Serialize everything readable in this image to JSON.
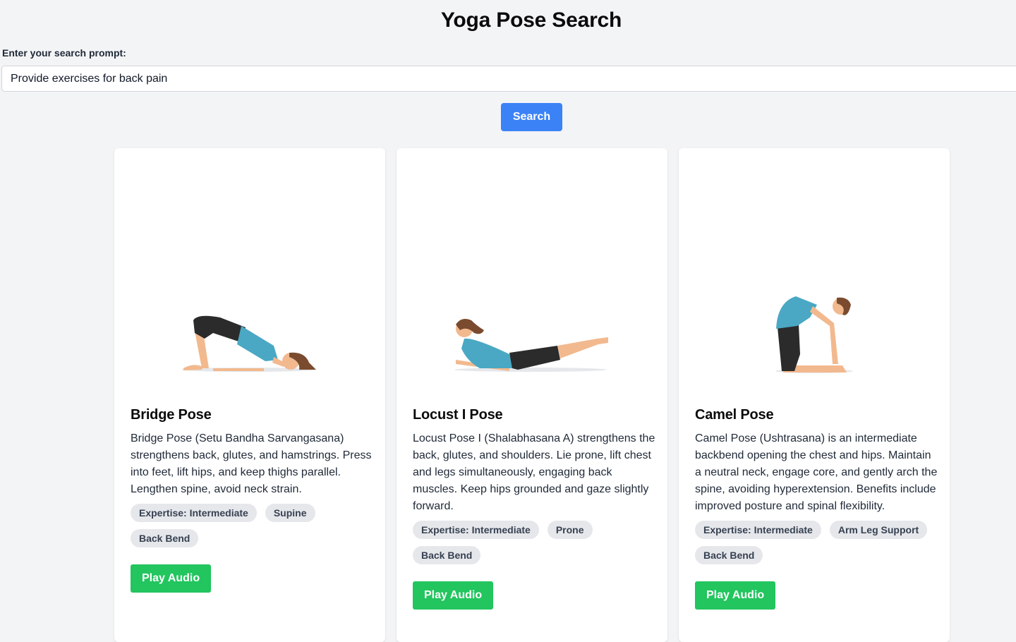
{
  "header": {
    "title": "Yoga Pose Search"
  },
  "search": {
    "label": "Enter your search prompt:",
    "value": "Provide exercises for back pain",
    "button_label": "Search"
  },
  "results": [
    {
      "title": "Bridge Pose",
      "image_icon": "bridge-pose-illustration",
      "description": "Bridge Pose (Setu Bandha Sarvangasana) strengthens back, glutes, and hamstrings. Press into feet, lift hips, and keep thighs parallel. Lengthen spine, avoid neck strain.",
      "tags": [
        "Expertise: Intermediate",
        "Supine",
        "Back Bend"
      ],
      "button_label": "Play Audio"
    },
    {
      "title": "Locust I Pose",
      "image_icon": "locust-pose-illustration",
      "description": "Locust Pose I (Shalabhasana A) strengthens the back, glutes, and shoulders. Lie prone, lift chest and legs simultaneously, engaging back muscles. Keep hips grounded and gaze slightly forward.",
      "tags": [
        "Expertise: Intermediate",
        "Prone",
        "Back Bend"
      ],
      "button_label": "Play Audio"
    },
    {
      "title": "Camel Pose",
      "image_icon": "camel-pose-illustration",
      "description": "Camel Pose (Ushtrasana) is an intermediate backbend opening the chest and hips. Maintain a neutral neck, engage core, and gently arch the spine, avoiding hyperextension. Benefits include improved posture and spinal flexibility.",
      "tags": [
        "Expertise: Intermediate",
        "Arm Leg Support",
        "Back Bend"
      ],
      "button_label": "Play Audio"
    }
  ],
  "colors": {
    "background": "#f3f4f6",
    "primary_button": "#3b82f6",
    "audio_button": "#22c55e",
    "tag_background": "#e5e7eb",
    "top_color": "#4aa8c4",
    "shorts_color": "#2b2b2b",
    "skin_color": "#f2b98e"
  }
}
